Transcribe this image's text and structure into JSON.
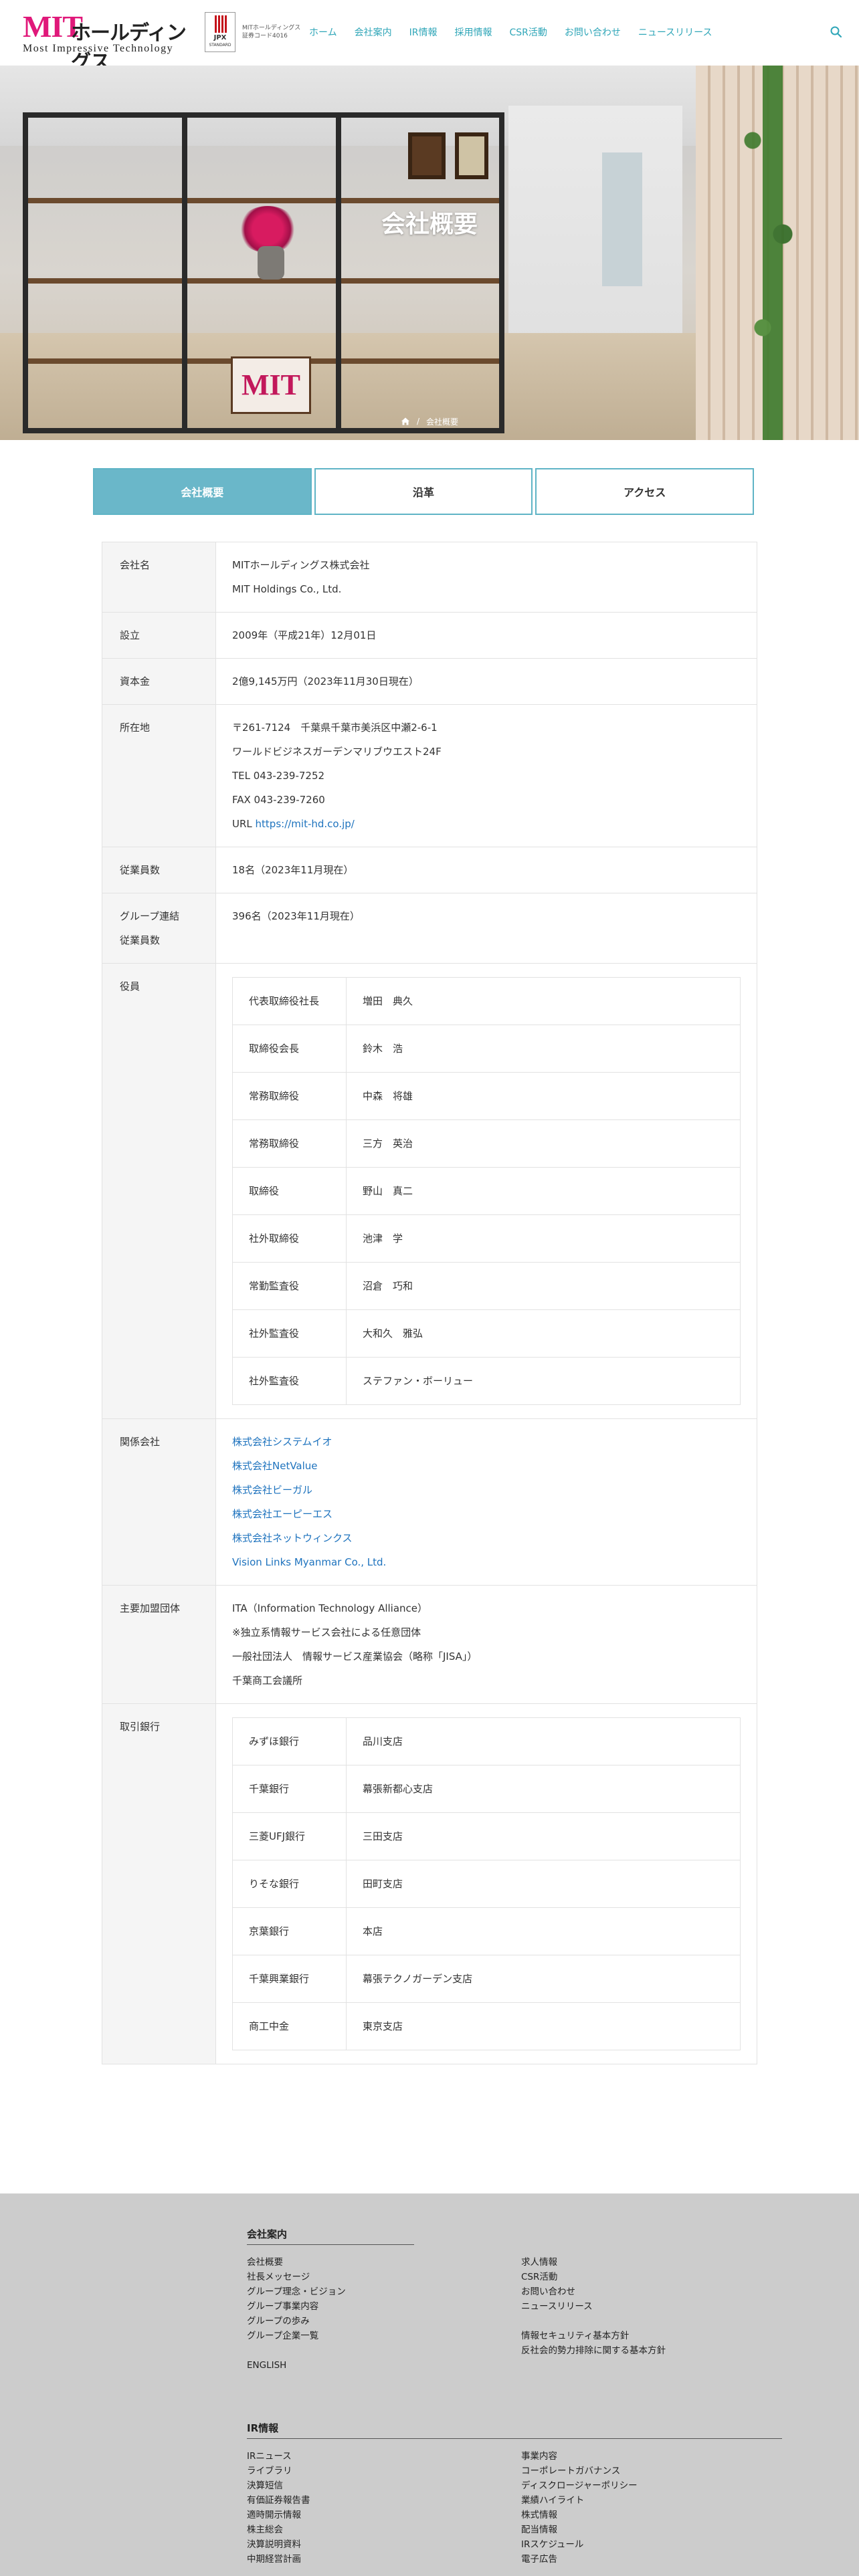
{
  "header": {
    "logo_main": "MIT",
    "logo_ja": "ホールディングス",
    "logo_sub": "Most Impressive Technology",
    "jpx_label": "JPX",
    "jpx_sub": "STANDARD",
    "stock_code": "MITホールディングス 証券コード4016",
    "nav": [
      "ホーム",
      "会社案内",
      "IR情報",
      "採用情報",
      "CSR活動",
      "お問い合わせ",
      "ニュースリリース"
    ],
    "accent_color": "#2fa6b8"
  },
  "hero": {
    "title": "会社概要",
    "breadcrumb_current": "会社概要"
  },
  "tabs": [
    {
      "label": "会社概要",
      "active": true
    },
    {
      "label": "沿革",
      "active": false
    },
    {
      "label": "アクセス",
      "active": false
    }
  ],
  "company": {
    "name_label": "会社名",
    "name_ja": "MITホールディングス株式会社",
    "name_en": "MIT Holdings Co., Ltd.",
    "founded_label": "設立",
    "founded": "2009年（平成21年）12月01日",
    "capital_label": "資本金",
    "capital": "2億9,145万円（2023年11月30日現在）",
    "address_label": "所在地",
    "address_lines": [
      "〒261-7124　千葉県千葉市美浜区中瀬2-6-1",
      "ワールドビジネスガーデンマリブウエスト24F",
      "TEL 043-239-7252",
      "FAX 043-239-7260"
    ],
    "url_prefix": "URL ",
    "url": "https://mit-hd.co.jp/",
    "employees_label": "従業員数",
    "employees": "18名（2023年11月現在）",
    "group_employees_label_1": "グループ連結",
    "group_employees_label_2": "従業員数",
    "group_employees": "396名（2023年11月現在）",
    "officers_label": "役員",
    "officers": [
      {
        "role": "代表取締役社長",
        "name": "増田　典久"
      },
      {
        "role": "取締役会長",
        "name": "鈴木　浩"
      },
      {
        "role": "常務取締役",
        "name": "中森　将雄"
      },
      {
        "role": "常務取締役",
        "name": "三方　英治"
      },
      {
        "role": "取締役",
        "name": "野山　真二"
      },
      {
        "role": "社外取締役",
        "name": "池津　学"
      },
      {
        "role": "常勤監査役",
        "name": "沼倉　巧和"
      },
      {
        "role": "社外監査役",
        "name": "大和久　雅弘"
      },
      {
        "role": "社外監査役",
        "name": "ステファン・ボーリュー"
      }
    ],
    "affiliates_label": "関係会社",
    "affiliates": [
      "株式会社システムイオ",
      "株式会社NetValue",
      "株式会社ビーガル",
      "株式会社エーピーエス",
      "株式会社ネットウィンクス",
      "Vision Links Myanmar Co., Ltd."
    ],
    "orgs_label": "主要加盟団体",
    "orgs": [
      "ITA（Information Technology Alliance）",
      "※独立系情報サービス会社による任意団体",
      "一般社団法人　情報サービス産業協会（略称「JISA」）",
      "千葉商工会議所"
    ],
    "banks_label": "取引銀行",
    "banks": [
      {
        "bank": "みずほ銀行",
        "branch": "品川支店"
      },
      {
        "bank": "千葉銀行",
        "branch": "幕張新都心支店"
      },
      {
        "bank": "三菱UFJ銀行",
        "branch": "三田支店"
      },
      {
        "bank": "りそな銀行",
        "branch": "田町支店"
      },
      {
        "bank": "京葉銀行",
        "branch": "本店"
      },
      {
        "bank": "千葉興業銀行",
        "branch": "幕張テクノガーデン支店"
      },
      {
        "bank": "商工中金",
        "branch": "東京支店"
      }
    ]
  },
  "footer": {
    "company_heading": "会社案内",
    "company_col1": [
      "会社概要",
      "社長メッセージ",
      "グループ理念・ビジョン",
      "グループ事業内容",
      "グループの歩み",
      "グループ企業一覧"
    ],
    "company_english": "ENGLISH",
    "company_col2": [
      "求人情報",
      "CSR活動",
      "お問い合わせ",
      "ニュースリリース"
    ],
    "company_col2b": [
      "情報セキュリティ基本方針",
      "反社会的勢力排除に関する基本方針"
    ],
    "ir_heading": "IR情報",
    "ir_col1": [
      "IRニュース",
      "ライブラリ",
      "決算短信",
      "有価証券報告書",
      "適時開示情報",
      "株主総会",
      "決算説明資料",
      "中期経営計画"
    ],
    "ir_col2": [
      "事業内容",
      "コーポレートガバナンス",
      "ディスクロージャーポリシー",
      "業績ハイライト",
      "株式情報",
      "配当情報",
      "IRスケジュール",
      "電子広告"
    ]
  }
}
